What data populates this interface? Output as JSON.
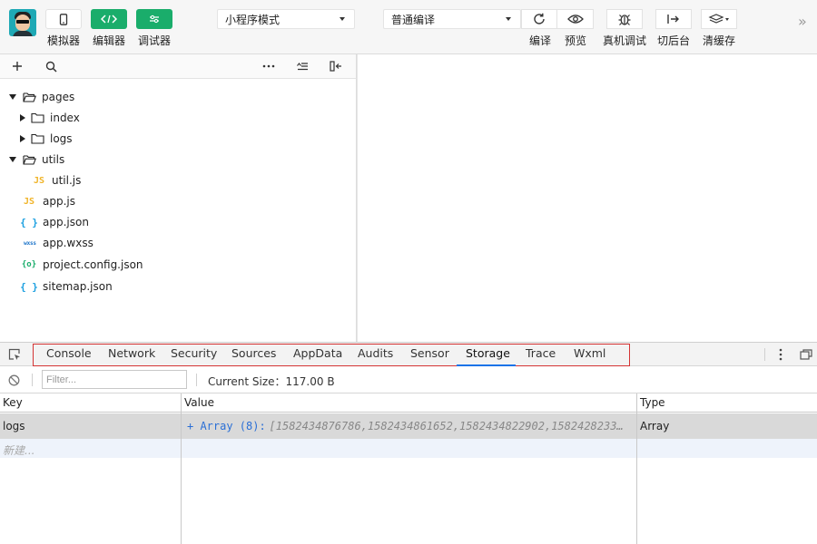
{
  "toolbar": {
    "simulator_label": "模拟器",
    "editor_label": "编辑器",
    "debugger_label": "调试器",
    "mode_select": "小程序模式",
    "compile_select": "普通编译",
    "compile_label": "编译",
    "preview_label": "预览",
    "remote_debug_label": "真机调试",
    "background_label": "切后台",
    "clear_cache_label": "清缓存",
    "accent_color": "#1aad6b"
  },
  "file_tree": {
    "items": [
      {
        "name": "pages",
        "type": "folder",
        "expanded": true
      },
      {
        "name": "index",
        "type": "folder",
        "expanded": false
      },
      {
        "name": "logs",
        "type": "folder",
        "expanded": false
      },
      {
        "name": "utils",
        "type": "folder",
        "expanded": true
      },
      {
        "name": "util.js",
        "type": "js",
        "icon": "JS"
      },
      {
        "name": "app.js",
        "type": "js",
        "icon": "JS"
      },
      {
        "name": "app.json",
        "type": "json",
        "icon": "{ }"
      },
      {
        "name": "app.wxss",
        "type": "wxss",
        "icon": "wxss"
      },
      {
        "name": "project.config.json",
        "type": "config",
        "icon": "{o}"
      },
      {
        "name": "sitemap.json",
        "type": "json",
        "icon": "{ }"
      }
    ]
  },
  "devtools": {
    "tabs": [
      "Console",
      "Network",
      "Security",
      "Sources",
      "AppData",
      "Audits",
      "Sensor",
      "Storage",
      "Trace",
      "Wxml"
    ],
    "active_tab": "Storage",
    "filter_placeholder": "Filter...",
    "current_size": "Current Size：117.00 B",
    "columns": {
      "key": "Key",
      "value": "Value",
      "type": "Type"
    },
    "rows": [
      {
        "key": "logs",
        "value_prefix": "+ Array (8):",
        "value_items": "[1582434876786,1582434861652,1582434822902,1582428233…",
        "type": "Array"
      }
    ],
    "new_row_placeholder": "新建..."
  }
}
